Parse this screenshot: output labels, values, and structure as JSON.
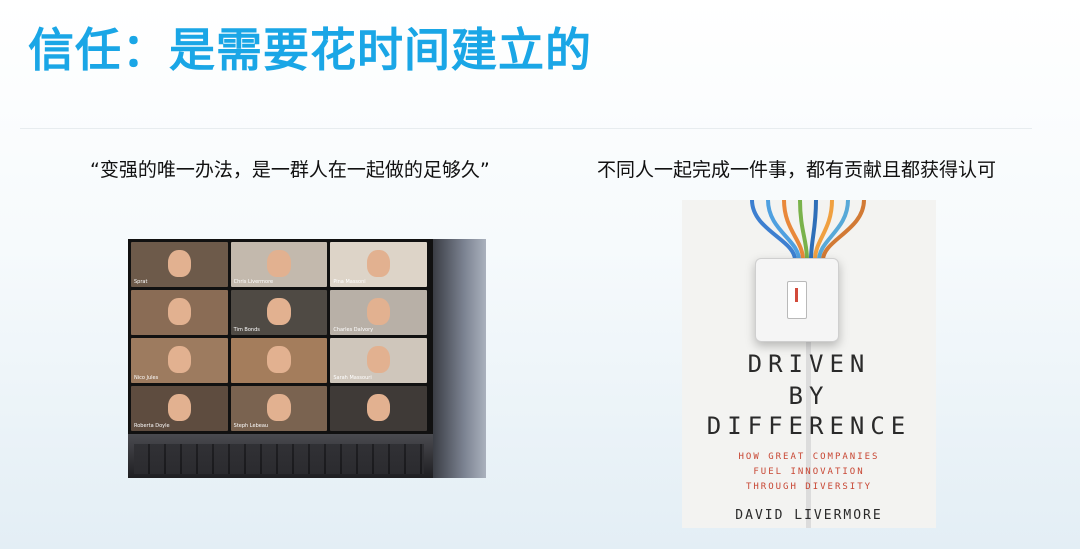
{
  "slide": {
    "title": "信任：是需要花时间建立的",
    "left_caption": "“变强的唯一办法，是一群人在一起做的足够久”",
    "right_caption": "不同人一起完成一件事，都有贡献且都获得认可"
  },
  "photo": {
    "tiles": [
      {
        "name": "Sprat",
        "bg": "#6d5a4a"
      },
      {
        "name": "Chris Livermore",
        "bg": "#c3b9ad"
      },
      {
        "name": "Pina Massoni",
        "bg": "#ddd4c8"
      },
      {
        "name": "",
        "bg": "#8a6c55"
      },
      {
        "name": "Tim Bonds",
        "bg": "#4f4a44"
      },
      {
        "name": "Charles Dalvory",
        "bg": "#b8b0a7"
      },
      {
        "name": "Nico Jules",
        "bg": "#9d7b5f"
      },
      {
        "name": "",
        "bg": "#a47d5c"
      },
      {
        "name": "Sarah Massouri",
        "bg": "#cfc6bb"
      },
      {
        "name": "Roberta Doyle",
        "bg": "#5e4c3f"
      },
      {
        "name": "Steph Lebeau",
        "bg": "#7a6350"
      },
      {
        "name": "",
        "bg": "#3f3a37"
      }
    ]
  },
  "book": {
    "title_line1": "DRIVEN",
    "title_line2": "BY",
    "title_line3": "DIFFERENCE",
    "subtitle_line1": "HOW GREAT COMPANIES",
    "subtitle_line2": "FUEL INNOVATION",
    "subtitle_line3": "THROUGH DIVERSITY",
    "author": "DAVID LIVERMORE",
    "wire_colors": [
      "#3d7fd0",
      "#4fa0e0",
      "#e9883a",
      "#7ab24a",
      "#2f6fb8",
      "#f0a040",
      "#58a9d8",
      "#d27a35"
    ]
  }
}
